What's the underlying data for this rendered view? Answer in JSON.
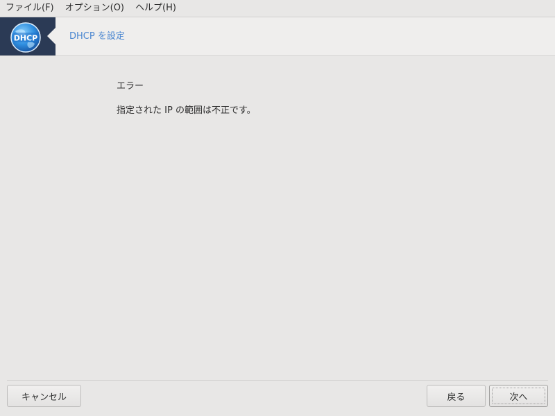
{
  "menubar": {
    "file": "ファイル(F)",
    "options": "オプション(O)",
    "help": "ヘルプ(H)"
  },
  "header": {
    "logo_text": "DHCP",
    "title": "DHCP を設定"
  },
  "content": {
    "error_title": "エラー",
    "error_message": "指定された IP の範囲は不正です。"
  },
  "buttons": {
    "cancel": "キャンセル",
    "back": "戻る",
    "next": "次へ"
  },
  "colors": {
    "accent": "#4a86d0",
    "logo_bg": "#2b3a55"
  }
}
